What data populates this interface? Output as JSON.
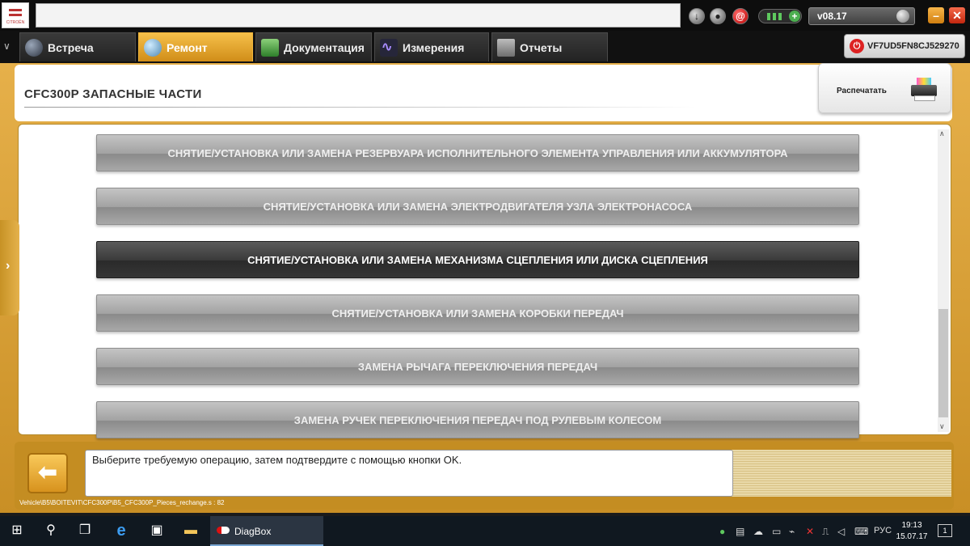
{
  "window": {
    "logo_brand": "CITROËN",
    "version": "v08.17",
    "minimize_glyph": "–",
    "close_glyph": "✕"
  },
  "tabs": [
    {
      "label": "Встреча",
      "icon": "globe-icon"
    },
    {
      "label": "Ремонт",
      "icon": "magnifier-icon",
      "active": true
    },
    {
      "label": "Документация",
      "icon": "book-icon"
    },
    {
      "label": "Измерения",
      "icon": "waveform-icon"
    },
    {
      "label": "Отчеты",
      "icon": "report-icon"
    }
  ],
  "vehicle": {
    "vin": "VF7UD5FN8CJ529270"
  },
  "page": {
    "title": "CFC300P  ЗАПАСНЫЕ ЧАСТИ",
    "print_label": "Распечатать"
  },
  "operations": [
    {
      "label": "СНЯТИЕ/УСТАНОВКА ИЛИ ЗАМЕНА РЕЗЕРВУАРА ИСПОЛНИТЕЛЬНОГО ЭЛЕМЕНТА УПРАВЛЕНИЯ ИЛИ АККУМУЛЯТОРА"
    },
    {
      "label": "СНЯТИЕ/УСТАНОВКА ИЛИ ЗАМЕНА ЭЛЕКТРОДВИГАТЕЛЯ УЗЛА ЭЛЕКТРОНАСОСА"
    },
    {
      "label": "СНЯТИЕ/УСТАНОВКА ИЛИ ЗАМЕНА МЕХАНИЗМА СЦЕПЛЕНИЯ ИЛИ ДИСКА СЦЕПЛЕНИЯ",
      "selected": true
    },
    {
      "label": "СНЯТИЕ/УСТАНОВКА ИЛИ ЗАМЕНА КОРОБКИ ПЕРЕДАЧ"
    },
    {
      "label": "ЗАМЕНА РЫЧАГА ПЕРЕКЛЮЧЕНИЯ ПЕРЕДАЧ"
    },
    {
      "label": "ЗАМЕНА РУЧЕК ПЕРЕКЛЮЧЕНИЯ ПЕРЕДАЧ ПОД РУЛЕВЫМ КОЛЕСОМ"
    }
  ],
  "message": "Выберите требуемую операцию, затем подтвердите с помощью кнопки OK.",
  "status_path": "Vehicle\\B5\\BOITEVIT\\CFC300P\\B5_CFC300P_Pieces_rechange.s : 82",
  "taskbar": {
    "app_label": "DiagBox",
    "language": "РУС",
    "time": "19:13",
    "date": "15.07.17",
    "notifications": "1"
  },
  "colors": {
    "accent": "#d99a2b",
    "selected_button": "#333333",
    "button": "#a5a5a5"
  }
}
